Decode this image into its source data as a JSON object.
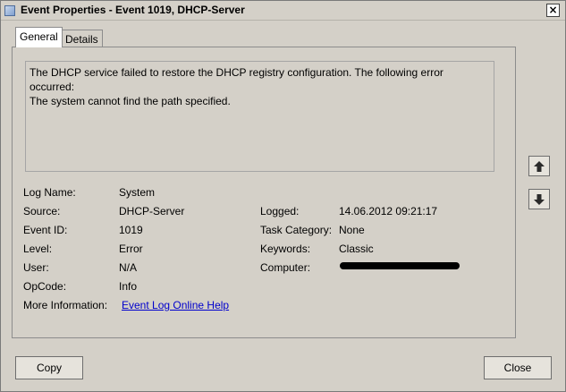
{
  "window": {
    "title": "Event Properties - Event 1019, DHCP-Server",
    "close_glyph": "×"
  },
  "tabs": [
    {
      "label": "General",
      "selected": true
    },
    {
      "label": "Details",
      "selected": false
    }
  ],
  "message": "The DHCP service failed to restore the DHCP registry configuration. The following error occurred:\nThe system cannot find the path specified.",
  "fields_left": [
    {
      "label": "Log Name:",
      "value": "System"
    },
    {
      "label": "Source:",
      "value": "DHCP-Server"
    },
    {
      "label": "Event ID:",
      "value": "1019"
    },
    {
      "label": "Level:",
      "value": "Error"
    },
    {
      "label": "User:",
      "value": "N/A"
    },
    {
      "label": "OpCode:",
      "value": "Info"
    },
    {
      "label": "More Information:",
      "value": "Event Log Online Help"
    }
  ],
  "fields_right": [
    {
      "label": "Logged:",
      "value": "14.06.2012 09:21:17"
    },
    {
      "label": "Task Category:",
      "value": "None"
    },
    {
      "label": "Keywords:",
      "value": "Classic"
    },
    {
      "label": "Computer:",
      "value": ""
    }
  ],
  "buttons": {
    "copy": "Copy",
    "close": "Close"
  },
  "icons": {
    "up": "arrow-up-icon",
    "down": "arrow-down-icon"
  }
}
